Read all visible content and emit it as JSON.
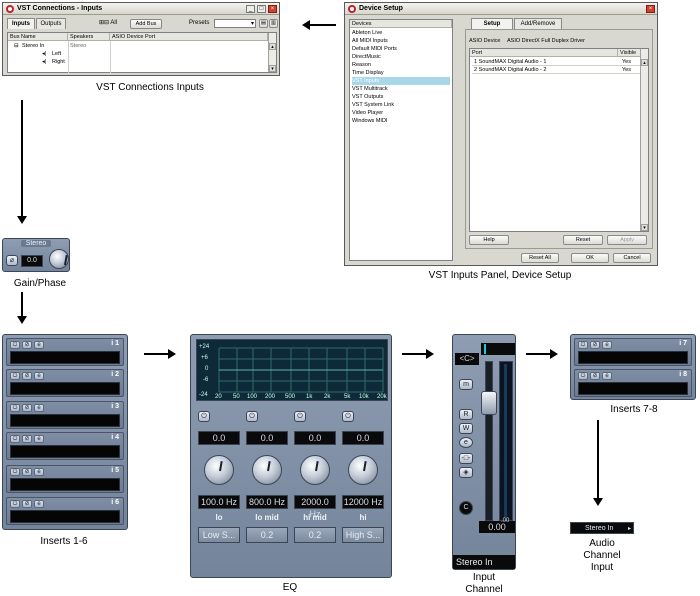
{
  "vst_connections": {
    "title": "VST Connections - Inputs",
    "tabs": [
      "Inputs",
      "Outputs"
    ],
    "all_label": "All",
    "add_bus_label": "Add Bus",
    "presets_label": "Presets",
    "columns": [
      "Bus Name",
      "Speakers",
      "ASIO Device Port"
    ],
    "rows": [
      {
        "name": "Stereo In",
        "speakers": "Stereo",
        "port": ""
      },
      {
        "name": "Left",
        "speakers": "",
        "port": ""
      },
      {
        "name": "Right",
        "speakers": "",
        "port": ""
      }
    ],
    "caption": "VST Connections Inputs"
  },
  "device_setup": {
    "title": "Device Setup",
    "devices_header": "Devices",
    "devices": [
      "Ableton Live",
      "All MIDI Inputs",
      "Default MIDI Ports",
      "DirectMusic",
      "Reason",
      "Time Display",
      "VST Inputs",
      "VST Multitrack",
      "VST Outputs",
      "VST System Link",
      "Video Player",
      "Windows MIDI"
    ],
    "selected_device": "VST Inputs",
    "tabs": [
      "Setup",
      "Add/Remove"
    ],
    "asio_device_label": "ASIO Device",
    "asio_device_value": "ASIO DirectX Full Duplex Driver",
    "port_header": "Port",
    "visible_header": "Visible",
    "ports": [
      {
        "name": "1 SoundMAX Digital Audio - 1",
        "visible": "Yes"
      },
      {
        "name": "2 SoundMAX Digital Audio - 2",
        "visible": "Yes"
      }
    ],
    "help_label": "Help",
    "reset_label": "Reset",
    "apply_label": "Apply",
    "reset_all_label": "Reset All",
    "ok_label": "OK",
    "cancel_label": "Cancel",
    "caption": "VST Inputs Panel, Device Setup"
  },
  "gain_phase": {
    "header": "Stereo",
    "value": "0.0",
    "caption": "Gain/Phase"
  },
  "inserts_1_6": {
    "slots": [
      "i 1",
      "i 2",
      "i 3",
      "i 4",
      "i 5",
      "i 6"
    ],
    "caption": "Inserts 1-6"
  },
  "eq": {
    "graph_db_labels": [
      "+24",
      "+6",
      "0",
      "-6",
      "-24"
    ],
    "graph_freq_labels": [
      "20",
      "50",
      "100",
      "200",
      "500",
      "1k",
      "2k",
      "5k",
      "10k",
      "20k"
    ],
    "bands": [
      {
        "gain": "0.0",
        "freq": "100.0 Hz",
        "label": "lo",
        "extra": "Low S..."
      },
      {
        "gain": "0.0",
        "freq": "800.0 Hz",
        "label": "lo mid",
        "extra": "0.2"
      },
      {
        "gain": "0.0",
        "freq": "2000.0 Hz",
        "label": "hi mid",
        "extra": "0.2"
      },
      {
        "gain": "0.0",
        "freq": "12000 Hz",
        "label": "hi",
        "extra": "High S..."
      }
    ],
    "caption": "EQ"
  },
  "input_channel": {
    "pan_label": "<C>",
    "buttons": [
      "m",
      "R",
      "W",
      "e"
    ],
    "fader_value": "0.00",
    "fader_value_small": ".00",
    "c_label": "C",
    "name": "Stereo In",
    "caption_line1": "Input",
    "caption_line2": "Channel"
  },
  "inserts_7_8": {
    "slots": [
      "i 7",
      "i 8"
    ],
    "caption": "Inserts 7-8"
  },
  "audio_channel_input": {
    "value": "Stereo In",
    "caption_line1": "Audio",
    "caption_line2": "Channel",
    "caption_line3": "Input"
  }
}
